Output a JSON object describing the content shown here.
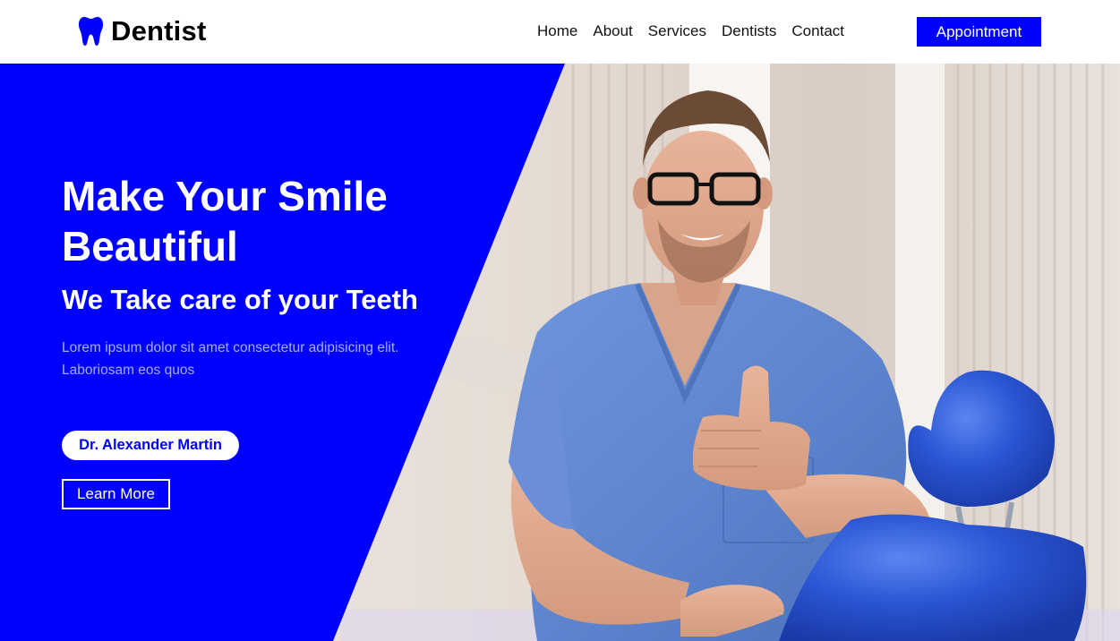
{
  "brand": {
    "name": "Dentist",
    "icon": "tooth-icon",
    "color": "#0000ff"
  },
  "nav": {
    "items": [
      {
        "label": "Home"
      },
      {
        "label": "About"
      },
      {
        "label": "Services"
      },
      {
        "label": "Dentists"
      },
      {
        "label": "Contact"
      }
    ],
    "cta_label": "Appointment"
  },
  "hero": {
    "title": "Make Your Smile Beautiful",
    "subtitle": "We Take care of your Teeth",
    "text": "Lorem ipsum dolor sit amet consectetur adipisicing elit. Laboriosam eos quos",
    "doctor_name": "Dr. Alexander Martin",
    "learn_more_label": "Learn More",
    "panel_color": "#0000ff"
  }
}
